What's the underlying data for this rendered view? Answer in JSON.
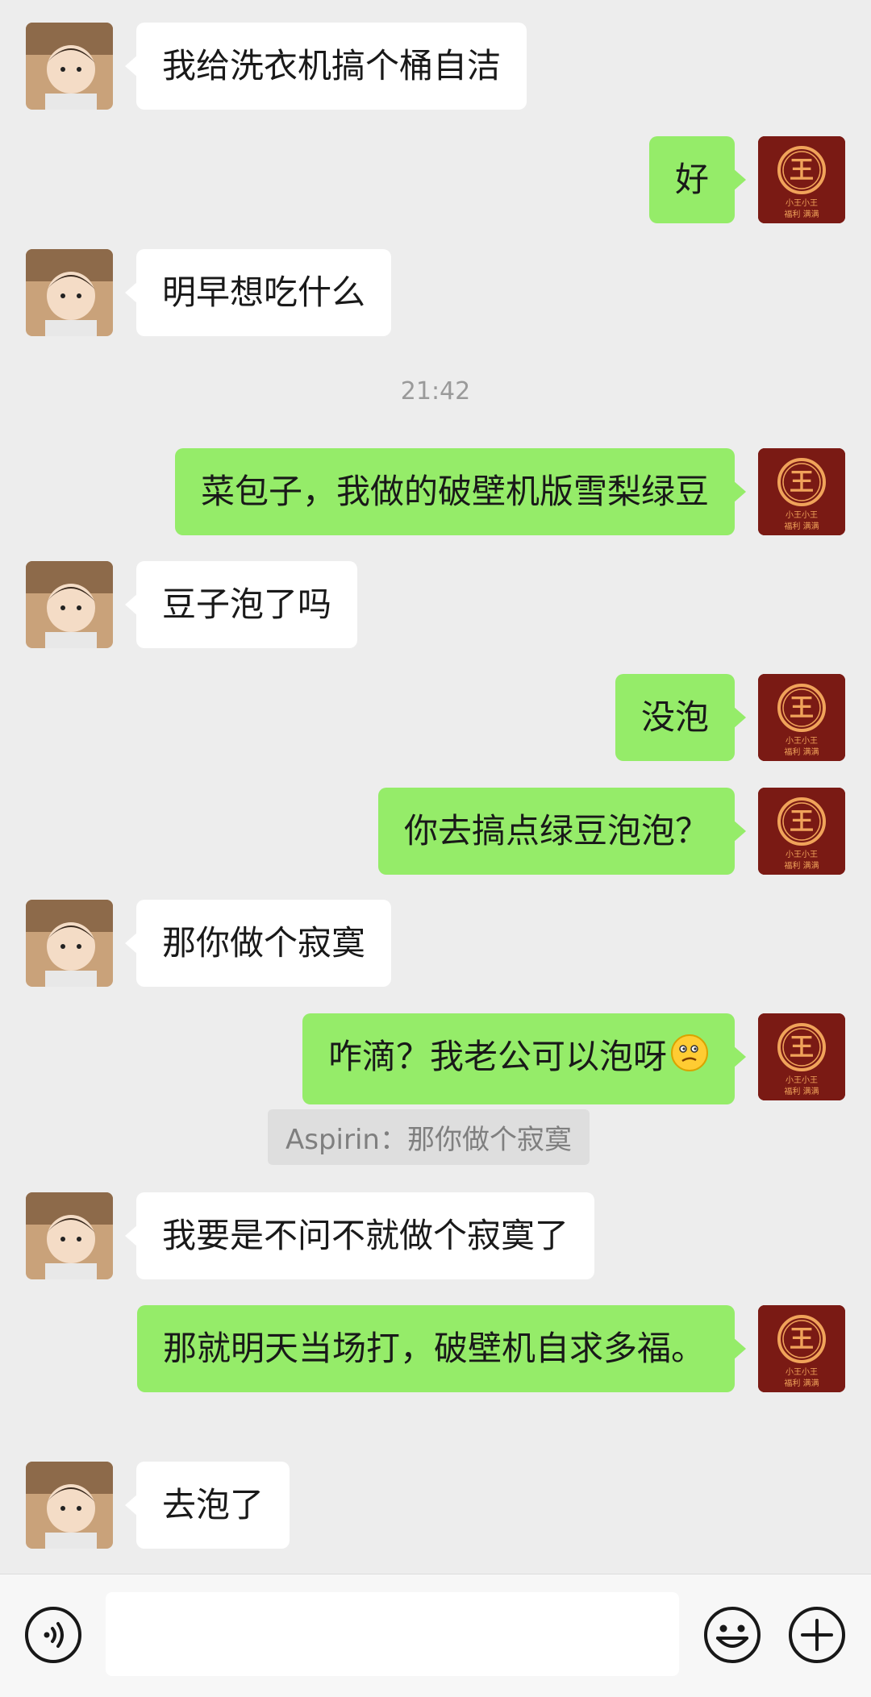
{
  "messages": [
    {
      "side": "in",
      "text": "我给洗衣机搞个桶自洁"
    },
    {
      "side": "out",
      "text": "好"
    },
    {
      "side": "in",
      "text": "明早想吃什么"
    },
    {
      "type": "time",
      "text": "21:42"
    },
    {
      "side": "out",
      "text": "菜包子，我做的破壁机版雪梨绿豆"
    },
    {
      "side": "in",
      "text": "豆子泡了吗"
    },
    {
      "side": "out",
      "text": "没泡"
    },
    {
      "side": "out",
      "text": "你去搞点绿豆泡泡？"
    },
    {
      "side": "in",
      "text": "那你做个寂寞"
    },
    {
      "side": "out",
      "text": "咋滴？我老公可以泡呀"
    },
    {
      "type": "quote",
      "text": "Aspirin：那你做个寂寞"
    },
    {
      "side": "in",
      "text": "我要是不问不就做个寂寞了"
    },
    {
      "side": "out",
      "text": "那就明天当场打，破壁机自求多福。"
    },
    {
      "side": "in",
      "text": "去泡了"
    }
  ],
  "my_avatar": {
    "seal_char": "王",
    "line1": "小王小王",
    "line2": "福利 满满"
  },
  "icons": {
    "emoji_in_message": "thinking-face-emoji",
    "voice": "voice-icon",
    "emoji": "emoji-icon",
    "add": "add-icon"
  },
  "colors": {
    "background": "#ededed",
    "outgoing_bubble": "#95ec69",
    "incoming_bubble": "#ffffff",
    "my_avatar_bg": "#7a1a14"
  }
}
